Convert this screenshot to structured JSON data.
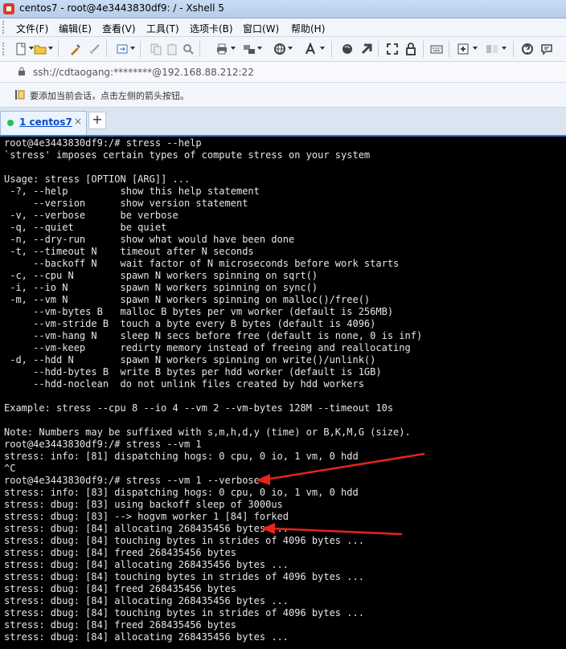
{
  "window": {
    "title": "centos7 - root@4e3443830df9: / - Xshell 5"
  },
  "menubar": {
    "items": [
      {
        "label": "文件(F)"
      },
      {
        "label": "编辑(E)"
      },
      {
        "label": "查看(V)"
      },
      {
        "label": "工具(T)"
      },
      {
        "label": "选项卡(B)"
      },
      {
        "label": "窗口(W)"
      },
      {
        "label": "帮助(H)"
      }
    ]
  },
  "toolbar": {
    "icons": [
      "new-session-icon",
      "open-folder-icon",
      "properties-icon",
      "disconnect-icon",
      "new-file-transfer-icon",
      "copy-icon",
      "paste-icon",
      "find-icon",
      "print-icon",
      "transfer-icon",
      "globe-icon",
      "font-icon",
      "xftp-icon",
      "xshell-icon",
      "fullscreen-icon",
      "lock-icon",
      "keyboard-icon",
      "add-icon",
      "layout-icon",
      "help-icon",
      "chat-icon"
    ]
  },
  "addressbar": {
    "url": "ssh://cdtaogang:********@192.168.88.212:22"
  },
  "hintbar": {
    "text": "要添加当前会话，点击左侧的箭头按钮。"
  },
  "tabs": {
    "active": {
      "label": "1 centos7",
      "status_color": "#27c24c"
    },
    "close_glyph": "×",
    "add_glyph": "+"
  },
  "terminal": {
    "lines": [
      "root@4e3443830df9:/# stress --help",
      "`stress' imposes certain types of compute stress on your system",
      "",
      "Usage: stress [OPTION [ARG]] ...",
      " -?, --help         show this help statement",
      "     --version      show version statement",
      " -v, --verbose      be verbose",
      " -q, --quiet        be quiet",
      " -n, --dry-run      show what would have been done",
      " -t, --timeout N    timeout after N seconds",
      "     --backoff N    wait factor of N microseconds before work starts",
      " -c, --cpu N        spawn N workers spinning on sqrt()",
      " -i, --io N         spawn N workers spinning on sync()",
      " -m, --vm N         spawn N workers spinning on malloc()/free()",
      "     --vm-bytes B   malloc B bytes per vm worker (default is 256MB)",
      "     --vm-stride B  touch a byte every B bytes (default is 4096)",
      "     --vm-hang N    sleep N secs before free (default is none, 0 is inf)",
      "     --vm-keep      redirty memory instead of freeing and reallocating",
      " -d, --hdd N        spawn N workers spinning on write()/unlink()",
      "     --hdd-bytes B  write B bytes per hdd worker (default is 1GB)",
      "     --hdd-noclean  do not unlink files created by hdd workers",
      "",
      "Example: stress --cpu 8 --io 4 --vm 2 --vm-bytes 128M --timeout 10s",
      "",
      "Note: Numbers may be suffixed with s,m,h,d,y (time) or B,K,M,G (size).",
      "root@4e3443830df9:/# stress --vm 1",
      "stress: info: [81] dispatching hogs: 0 cpu, 0 io, 1 vm, 0 hdd",
      "^C",
      "root@4e3443830df9:/# stress --vm 1 --verbose",
      "stress: info: [83] dispatching hogs: 0 cpu, 0 io, 1 vm, 0 hdd",
      "stress: dbug: [83] using backoff sleep of 3000us",
      "stress: dbug: [83] --> hogvm worker 1 [84] forked",
      "stress: dbug: [84] allocating 268435456 bytes ...",
      "stress: dbug: [84] touching bytes in strides of 4096 bytes ...",
      "stress: dbug: [84] freed 268435456 bytes",
      "stress: dbug: [84] allocating 268435456 bytes ...",
      "stress: dbug: [84] touching bytes in strides of 4096 bytes ...",
      "stress: dbug: [84] freed 268435456 bytes",
      "stress: dbug: [84] allocating 268435456 bytes ...",
      "stress: dbug: [84] touching bytes in strides of 4096 bytes ...",
      "stress: dbug: [84] freed 268435456 bytes",
      "stress: dbug: [84] allocating 268435456 bytes ..."
    ],
    "annotation_color": "#e8231c"
  }
}
